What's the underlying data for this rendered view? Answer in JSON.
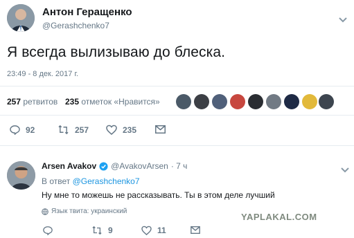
{
  "tweet": {
    "author_name": "Антон Геращенко",
    "author_handle": "@Gerashchenko7",
    "text": "Я всегда вылизываю до блеска.",
    "timestamp": "23:49 - 8 дек. 2017 г.",
    "retweets_count": "257",
    "retweets_label": "ретвитов",
    "likes_count": "235",
    "likes_label": "отметок «Нравится»",
    "actions": {
      "reply_count": "92",
      "retweet_count": "257",
      "like_count": "235"
    }
  },
  "reply": {
    "author_name": "Arsen Avakov",
    "author_handle": "@AvakovArsen",
    "time": "· 7 ч",
    "reply_to_prefix": "В ответ",
    "reply_to_handle": "@Gerashchenko7",
    "text": "Ну мне то можешь не рассказывать. Ты в этом деле лучший",
    "language_note": "Язык твита: украинский",
    "actions": {
      "retweet_count": "9",
      "like_count": "11"
    }
  },
  "watermark": "YAPLAKAL.COM",
  "colors": {
    "verified": "#1da1f2",
    "muted": "#657786",
    "link": "#1b95e0",
    "watermark": "#7f8a7f"
  }
}
